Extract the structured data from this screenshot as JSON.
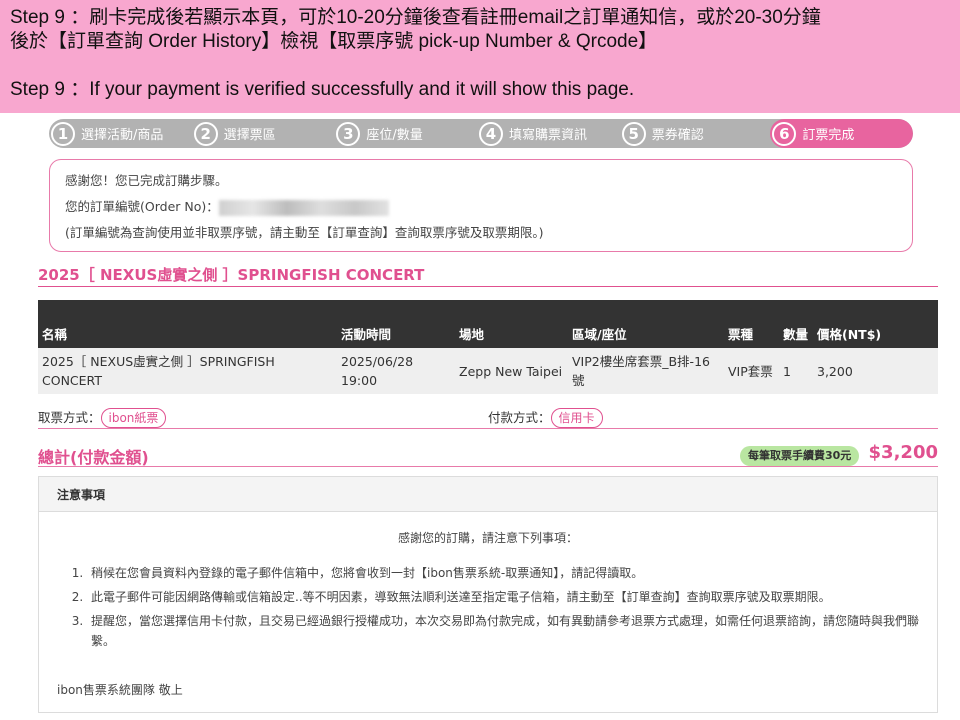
{
  "banner": {
    "line1": "Step 9 ：刷卡完成後若顯示本頁，可於10-20分鐘後查看註冊email之訂單通知信，或於20-30分鐘",
    "line2": "後於【訂單查詢 Order History】檢視【取票序號 pick-up Number & Qrcode】",
    "line3": "Step 9 ：If your payment is verified successfully and it will show this page."
  },
  "steps": [
    {
      "num": "1",
      "label": "選擇活動/商品"
    },
    {
      "num": "2",
      "label": "選擇票區"
    },
    {
      "num": "3",
      "label": "座位/數量"
    },
    {
      "num": "4",
      "label": "填寫購票資訊"
    },
    {
      "num": "5",
      "label": "票券確認"
    },
    {
      "num": "6",
      "label": "訂票完成"
    }
  ],
  "thanks": {
    "line1": "感謝您！您已完成訂購步驟。",
    "order_label": "您的訂單編號(Order No)：",
    "line3": "(訂單編號為查詢使用並非取票序號，請主動至【訂單查詢】查詢取票序號及取票期限。)"
  },
  "event_title": "2025［ NEXUS虛實之側 ］SPRINGFISH CONCERT",
  "table": {
    "headers": [
      "名稱",
      "活動時間",
      "場地",
      "區域/座位",
      "票種",
      "數量",
      "價格(NT$)"
    ],
    "row": [
      "2025［ NEXUS虛實之側 ］SPRINGFISH CONCERT",
      "2025/06/28 19:00",
      "Zepp New Taipei",
      "VIP2樓坐席套票_B排-16號",
      "VIP套票",
      "1",
      "3,200"
    ]
  },
  "pickup": {
    "label": "取票方式：",
    "value": "ibon紙票"
  },
  "payment": {
    "label": "付款方式：",
    "value": "信用卡"
  },
  "total": {
    "label": "總計(付款金額)",
    "fee_badge": "每筆取票手續費30元",
    "amount": "$3,200"
  },
  "notice": {
    "title": "注意事項",
    "intro": "感謝您的訂購，請注意下列事項：",
    "items": [
      "稍候在您會員資料內登錄的電子郵件信箱中，您將會收到一封【ibon售票系統-取票通知】，請記得讀取。",
      "此電子郵件可能因網路傳輸或信箱設定..等不明因素，導致無法順利送達至指定電子信箱，請主動至【訂單查詢】查詢取票序號及取票期限。",
      "提醒您，當您選擇信用卡付款，且交易已經過銀行授權成功，本次交易即為付款完成，如有異動請參考退票方式處理，如需任何退票諮詢，請您隨時與我們聯繫。"
    ],
    "signoff": "ibon售票系統團隊 敬上"
  }
}
